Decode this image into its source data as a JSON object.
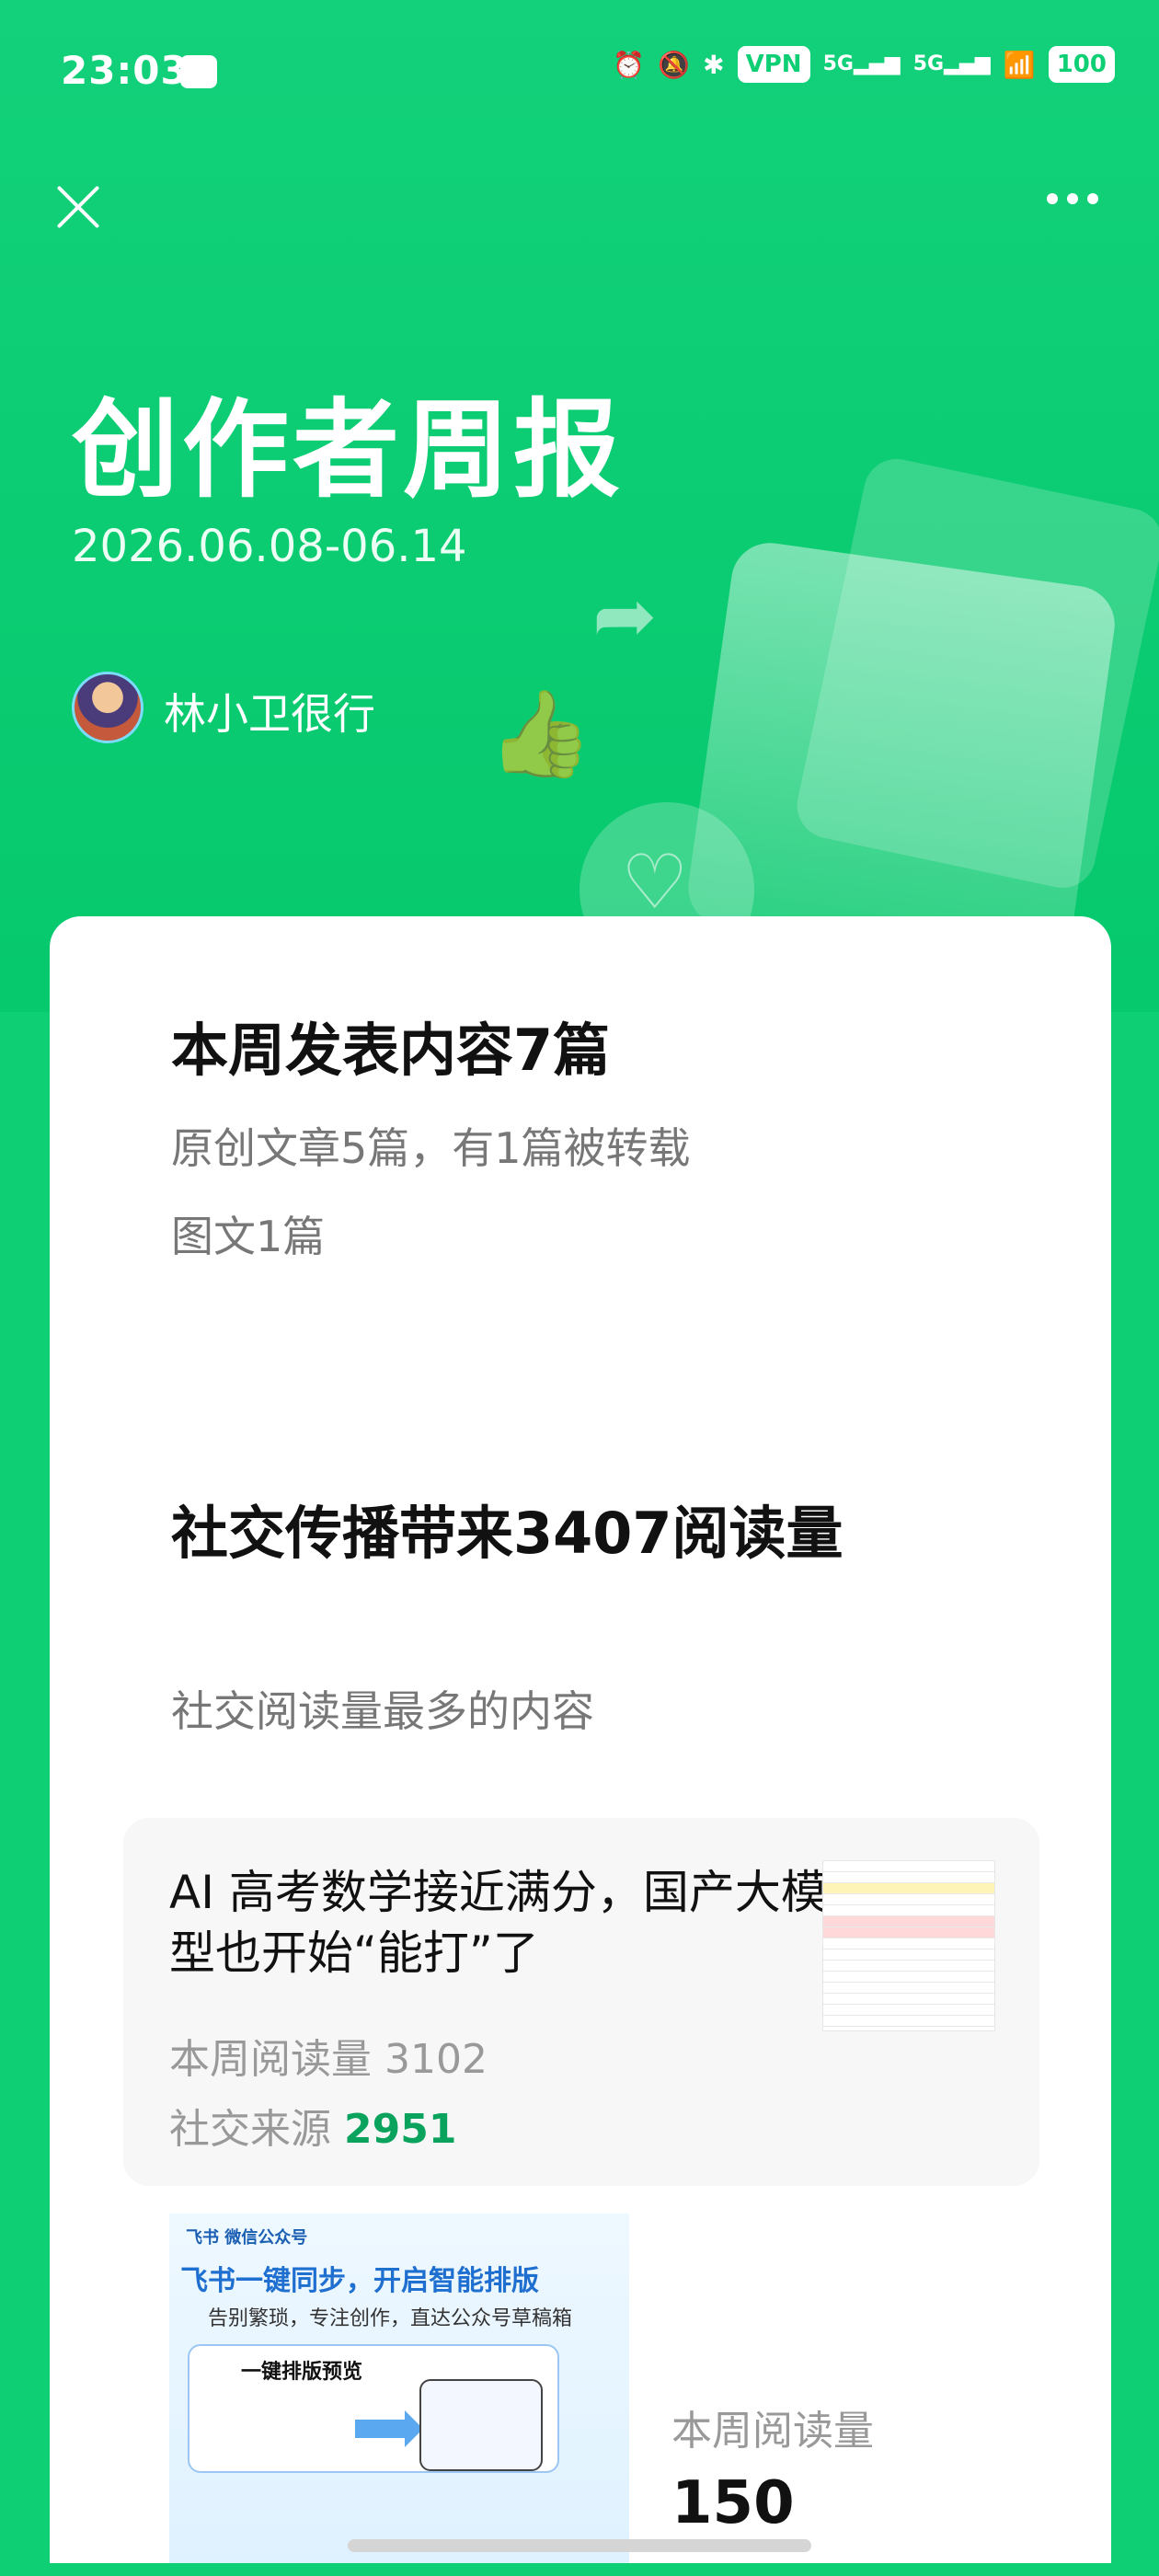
{
  "status_bar": {
    "time": "23:03",
    "vpn": "VPN",
    "network1": "5G",
    "network2": "5G",
    "battery": "100"
  },
  "header": {
    "title": "创作者周报",
    "date_range": "2026.06.08-06.14",
    "author": "林小卫很行"
  },
  "summary": {
    "headline": "本周发表内容7篇",
    "line1": "原创文章5篇，有1篇被转载",
    "line2": "图文1篇"
  },
  "social": {
    "headline": "社交传播带来3407阅读量",
    "section_label": "社交阅读量最多的内容",
    "top_article": {
      "title": "AI 高考数学接近满分，国产大模型也开始“能打”了",
      "read_label": "本周阅读量 3102",
      "social_label": "社交来源",
      "social_value": "2951"
    }
  },
  "second_article": {
    "promo_top": "飞书 微信公众号",
    "promo_main": "飞书一键同步，开启智能排版",
    "promo_sub": "告别繁琐，专注创作，直达公众号草稿箱",
    "promo_box_title": "一键排版预览",
    "read_label": "本周阅读量",
    "read_value": "150"
  },
  "icons": [
    "close-icon",
    "more-icon",
    "share-icon",
    "like-icon",
    "heart-icon"
  ]
}
